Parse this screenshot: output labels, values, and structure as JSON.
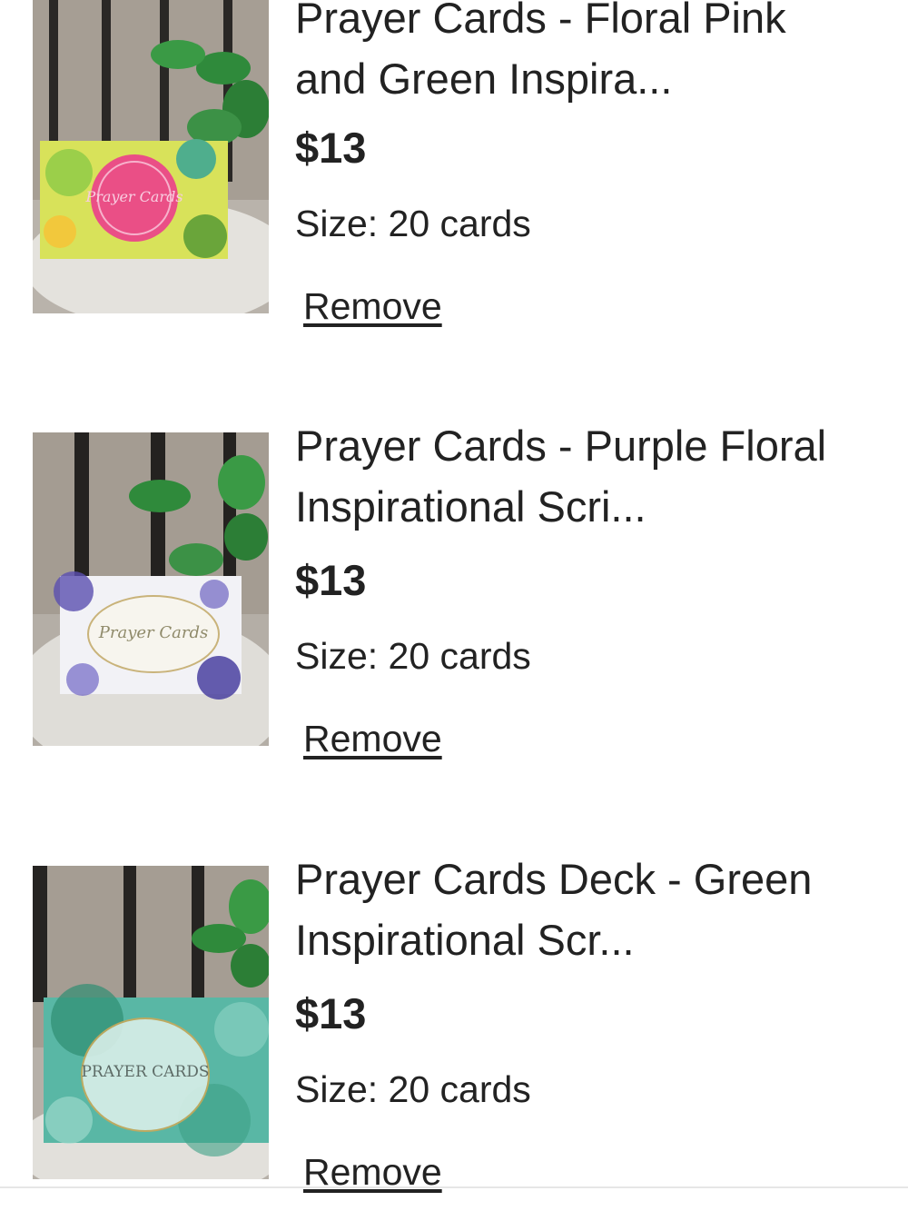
{
  "cart": {
    "items": [
      {
        "title": "Prayer Cards - Floral Pink and Green Inspira...",
        "price": "$13",
        "size": "Size: 20 cards",
        "remove_label": "Remove",
        "card_label": "Prayer Cards"
      },
      {
        "title": "Prayer Cards - Purple Floral Inspirational Scri...",
        "price": "$13",
        "size": "Size: 20 cards",
        "remove_label": "Remove",
        "card_label": "Prayer Cards"
      },
      {
        "title": "Prayer Cards Deck - Green Inspirational Scr...",
        "price": "$13",
        "size": "Size: 20 cards",
        "remove_label": "Remove",
        "card_label": "PRAYER CARDS"
      }
    ]
  }
}
